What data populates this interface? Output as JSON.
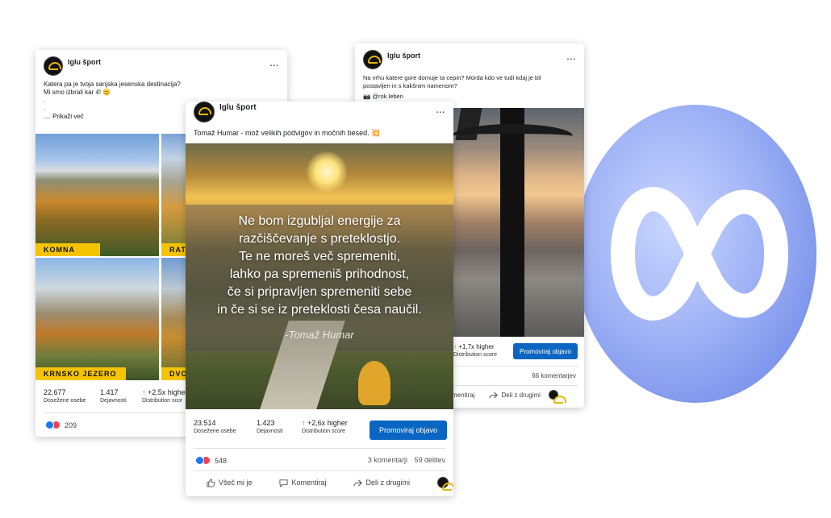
{
  "colors": {
    "accent_blue": "#0a66c2",
    "growth_green": "#2bb04a",
    "tag_yellow": "#f5c400",
    "meta_blue": "#8da2f0"
  },
  "icons": {
    "meta_logo": "meta-infinity-icon",
    "like": "thumbs-up-icon",
    "comment": "comment-icon",
    "share": "share-icon",
    "more": "more-dots-icon"
  },
  "left_post": {
    "page_name": "Iglu šport",
    "more": "...",
    "caption_line1": "Katera pa je tvoja sanjska jesenska destinacija?",
    "caption_line2": "Mi smo izbrali kar 4! 😊",
    "dot1": ".",
    "dot2": ".",
    "show_more": ".... Prikaži več",
    "tags": [
      "KOMNA",
      "RAT",
      "KRNSKO JEZERO",
      "DVO"
    ],
    "reach_value": "22.677",
    "reach_label": "Dosežene osebe",
    "engagement_value": "1.417",
    "engagement_label": "Dejavnosti",
    "distribution_value": "+2,5x higher",
    "distribution_label": "Distribution scor",
    "reactions_count": "209"
  },
  "center_post": {
    "page_name": "Iglu šport",
    "more": "...",
    "caption": "Tomaž Humar - mož velikih podvigov in močnih besed. 💥",
    "quote_lines": [
      "Ne bom izgubljal energije za",
      "razčiščevanje s preteklostjo.",
      "Te ne moreš več spremeniti,",
      "lahko pa spremeniš prihodnost,",
      "če si pripravljen spremeniti sebe",
      "in če si se iz preteklosti česa naučil."
    ],
    "quote_author": "-Tomaž Humar",
    "reach_value": "23.514",
    "reach_label": "Dosežene osebe",
    "engagement_value": "1.423",
    "engagement_label": "Dejavnosti",
    "distribution_value": "+2,6x higher",
    "distribution_label": "Distribution score",
    "promote_label": "Promoviraj objavo",
    "reactions_count": "548",
    "comments": "3 komentarji",
    "shares": "59 delitev",
    "like_label": "Všeč mi je",
    "comment_label": "Komentiraj",
    "share_label": "Deli z drugimi"
  },
  "right_post": {
    "page_name": "Iglu šport",
    "more": "...",
    "caption_line1": "Na vrhu katere gore domuje ta cepin?  Morda kdo ve tudi kdaj je bil",
    "caption_line2": "postavljen in s kakšnim namenom?",
    "credit": "📷 @rok.leben",
    "distribution_value": "+1,7x higher",
    "distribution_label": "Distribution score",
    "promote_label": "Promoviraj objavo",
    "comments": "66 komentarjev",
    "comment_label": "mentiraj",
    "share_label": "Deli z drugimi"
  }
}
